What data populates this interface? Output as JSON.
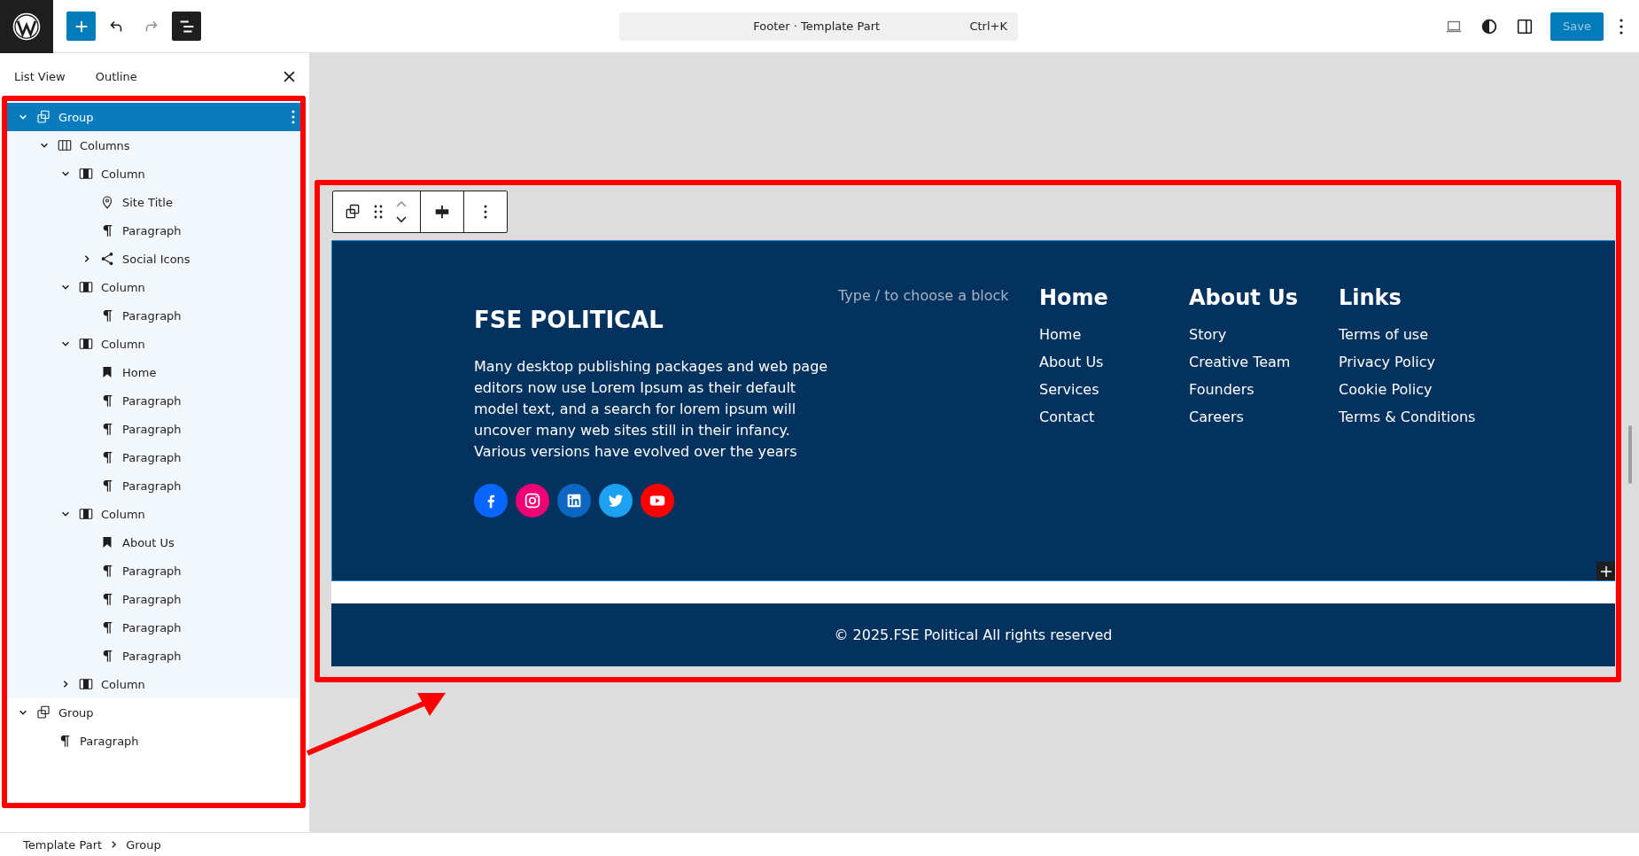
{
  "topbar": {
    "history": [
      {
        "kind": "undo",
        "disabled": false
      },
      {
        "kind": "redo",
        "disabled": true
      }
    ],
    "list_view_open": true,
    "command_bar": {
      "title": "Footer · Template Part",
      "shortcut": "Ctrl+K"
    },
    "save_button": {
      "label": "Save",
      "disabled": true
    }
  },
  "sidebar": {
    "tabs": [
      "List View",
      "Outline"
    ],
    "tree": [
      {
        "label": "Group",
        "kind": "group",
        "selected": true,
        "expanded": true,
        "children": [
          {
            "label": "Columns",
            "kind": "columns",
            "selected": false,
            "expanded": true,
            "children": [
              {
                "label": "Column",
                "kind": "column",
                "selected": false,
                "expanded": true,
                "children": [
                  {
                    "label": "Site Title",
                    "kind": "site-title",
                    "selected": false
                  },
                  {
                    "label": "Paragraph",
                    "kind": "paragraph",
                    "selected": false
                  },
                  {
                    "label": "Social Icons",
                    "kind": "social",
                    "selected": false,
                    "expanded": false
                  }
                ]
              },
              {
                "label": "Column",
                "kind": "column",
                "selected": false,
                "expanded": true,
                "children": [
                  {
                    "label": "Paragraph",
                    "kind": "paragraph",
                    "selected": false
                  }
                ]
              },
              {
                "label": "Column",
                "kind": "column",
                "selected": false,
                "expanded": true,
                "children": [
                  {
                    "label": "Home",
                    "kind": "heading",
                    "selected": false
                  },
                  {
                    "label": "Paragraph",
                    "kind": "paragraph",
                    "selected": false
                  },
                  {
                    "label": "Paragraph",
                    "kind": "paragraph",
                    "selected": false
                  },
                  {
                    "label": "Paragraph",
                    "kind": "paragraph",
                    "selected": false
                  },
                  {
                    "label": "Paragraph",
                    "kind": "paragraph",
                    "selected": false
                  }
                ]
              },
              {
                "label": "Column",
                "kind": "column",
                "selected": false,
                "expanded": true,
                "children": [
                  {
                    "label": "About Us",
                    "kind": "heading",
                    "selected": false
                  },
                  {
                    "label": "Paragraph",
                    "kind": "paragraph",
                    "selected": false
                  },
                  {
                    "label": "Paragraph",
                    "kind": "paragraph",
                    "selected": false
                  },
                  {
                    "label": "Paragraph",
                    "kind": "paragraph",
                    "selected": false
                  },
                  {
                    "label": "Paragraph",
                    "kind": "paragraph",
                    "selected": false
                  }
                ]
              },
              {
                "label": "Column",
                "kind": "column",
                "selected": false,
                "expanded": false
              }
            ]
          }
        ]
      },
      {
        "label": "Group",
        "kind": "group",
        "selected": false,
        "expanded": true,
        "children": [
          {
            "label": "Paragraph",
            "kind": "paragraph",
            "selected": false
          }
        ]
      }
    ]
  },
  "footer": {
    "site_title": "FSE POLITICAL",
    "description": "Many desktop publishing packages and web page editors now use Lorem Ipsum as their default model text, and a search for lorem ipsum will uncover many web sites still in their infancy. Various versions have evolved over the years",
    "social": [
      {
        "kind": "facebook",
        "color": "#0866ff"
      },
      {
        "kind": "instagram",
        "color": "#f00075"
      },
      {
        "kind": "linkedin",
        "color": "#0d66c2"
      },
      {
        "kind": "twitter",
        "color": "#1da1f2"
      },
      {
        "kind": "youtube",
        "color": "#ff0000"
      }
    ],
    "block_placeholder": "Type / to choose a block",
    "menus": [
      {
        "heading": "Home",
        "links": [
          "Home",
          "About Us",
          "Services",
          "Contact"
        ]
      },
      {
        "heading": "About Us",
        "links": [
          "Story",
          "Creative Team",
          "Founders",
          "Careers"
        ]
      },
      {
        "heading": "Links",
        "links": [
          "Terms of use",
          "Privacy Policy",
          "Cookie Policy",
          "Terms & Conditions"
        ]
      }
    ],
    "copyright": "© 2025.FSE Political All rights reserved"
  },
  "breadcrumbs": [
    "Template Part",
    "Group"
  ]
}
